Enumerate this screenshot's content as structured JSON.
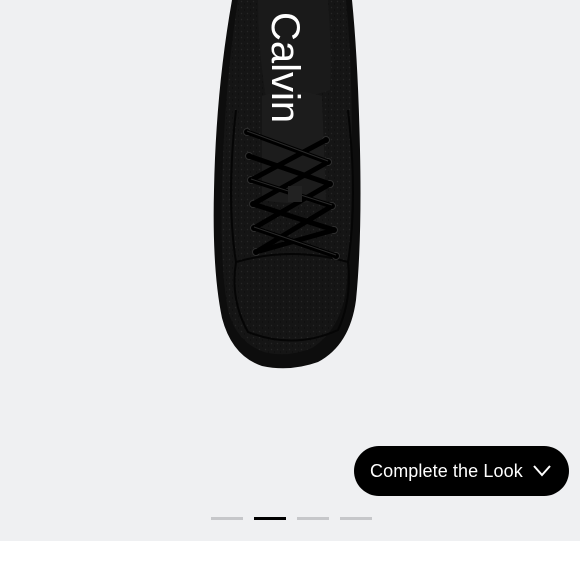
{
  "product": {
    "brand_text": "Calvin",
    "image_alt": "Black leather lace-up sneaker, top view"
  },
  "complete_look": {
    "label": "Complete the Look",
    "icon": "chevron-down-icon"
  },
  "pagination": {
    "total": 4,
    "active_index": 1
  },
  "colors": {
    "background": "#eff0f2",
    "button": "#000000",
    "button_text": "#ffffff",
    "dot_inactive": "#c6c7ca",
    "dot_active": "#000000"
  }
}
